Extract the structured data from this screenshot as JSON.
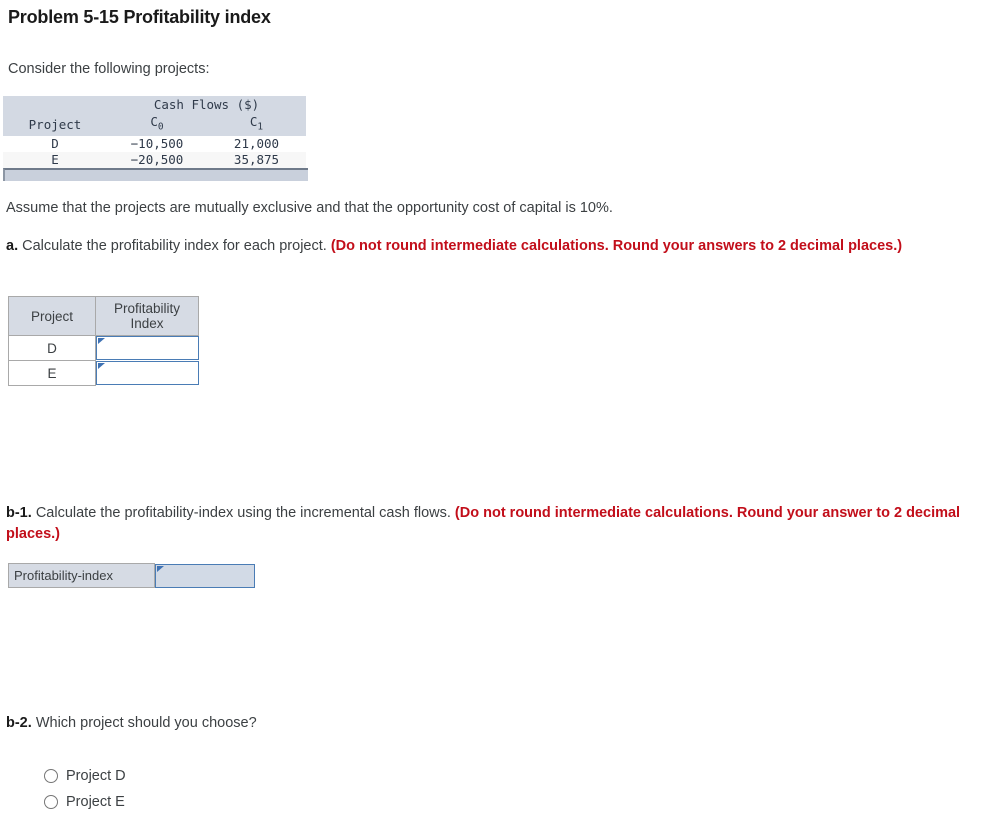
{
  "title": "Problem 5-15 Profitability index",
  "intro": "Consider the following projects:",
  "cash_flow_table": {
    "group_header": "Cash Flows ($)",
    "columns": [
      "Project",
      "C0",
      "C1"
    ],
    "col_project": "Project",
    "col_c0_base": "C",
    "col_c0_sub": "0",
    "col_c1_base": "C",
    "col_c1_sub": "1",
    "rows": [
      {
        "project": "D",
        "c0": "−10,500",
        "c1": "21,000"
      },
      {
        "project": "E",
        "c0": "−20,500",
        "c1": "35,875"
      }
    ]
  },
  "assume_text": "Assume that the projects are mutually exclusive and that the opportunity cost of capital is 10%.",
  "part_a": {
    "label": "a.",
    "prompt": "Calculate the profitability index for each project.",
    "instruction": "(Do not round intermediate calculations. Round your answers to 2 decimal places.)",
    "table": {
      "header_project": "Project",
      "header_index_line1": "Profitability",
      "header_index_line2": "Index",
      "rows": [
        {
          "project": "D",
          "value": ""
        },
        {
          "project": "E",
          "value": ""
        }
      ]
    }
  },
  "part_b1": {
    "label": "b-1.",
    "prompt": "Calculate the profitability-index using the incremental cash flows.",
    "instruction": "(Do not round intermediate calculations. Round your answer to 2 decimal places.)",
    "row_label": "Profitability-index",
    "value": ""
  },
  "part_b2": {
    "label": "b-2.",
    "prompt": "Which project should you choose?",
    "options": [
      {
        "label": "Project D",
        "selected": false
      },
      {
        "label": "Project E",
        "selected": false
      }
    ]
  },
  "colors": {
    "red_instruction": "#c20e1a",
    "header_fill": "#d6dbe4",
    "input_border": "#4a7cb5",
    "input_filled": "#d2dae6",
    "text": "#3c4043"
  }
}
